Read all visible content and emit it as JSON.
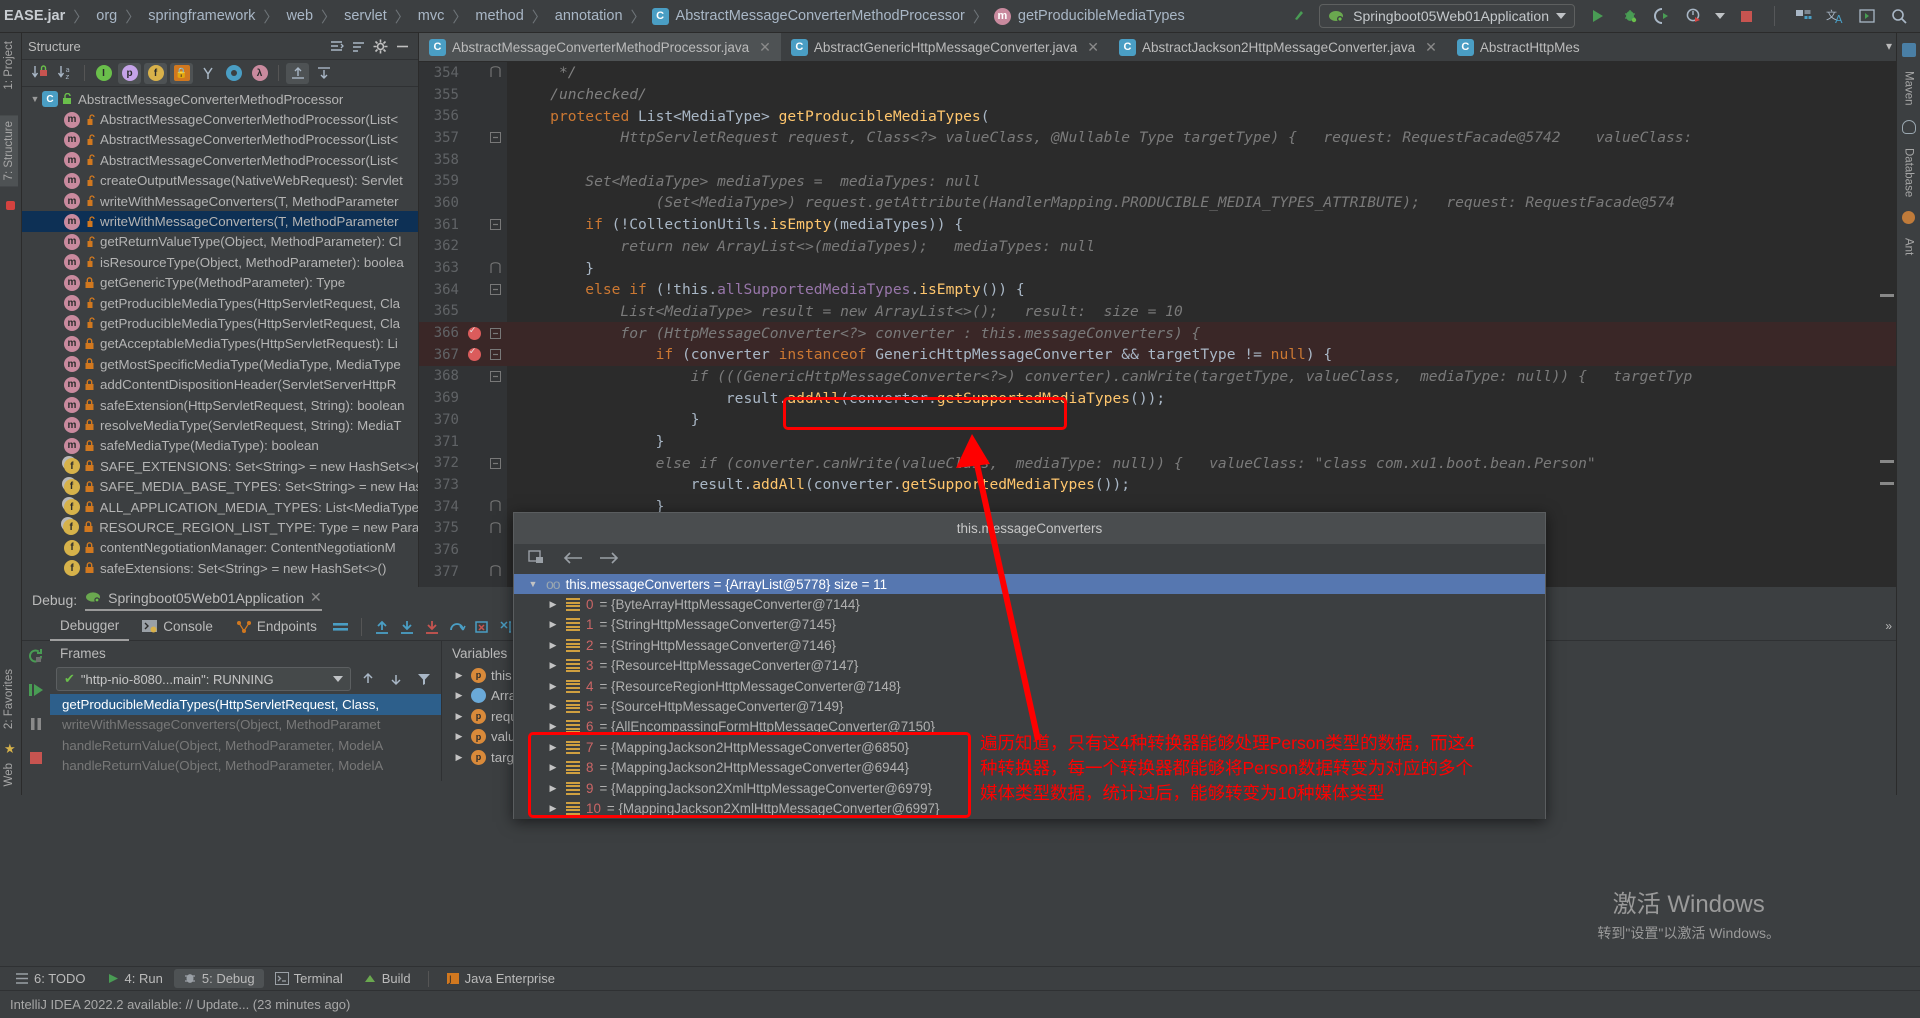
{
  "topbar": {
    "breadcrumb": [
      {
        "text": "EASE.jar",
        "bold": true
      },
      {
        "text": "org"
      },
      {
        "text": "springframework"
      },
      {
        "text": "web"
      },
      {
        "text": "servlet"
      },
      {
        "text": "mvc"
      },
      {
        "text": "method"
      },
      {
        "text": "annotation"
      },
      {
        "text": "AbstractMessageConverterMethodProcessor",
        "icon": "class"
      },
      {
        "text": "getProducibleMediaTypes",
        "icon": "method"
      }
    ],
    "run_config": "Springboot05Web01Application",
    "buttons": [
      "run",
      "debug",
      "run-with-coverage",
      "profiler",
      "stop",
      "services",
      "translate",
      "console",
      "search"
    ]
  },
  "left_rail": {
    "tabs": [
      "1: Project",
      "7: Structure"
    ]
  },
  "right_rail": {
    "tabs": [
      "Maven",
      "Database",
      "Ant"
    ]
  },
  "structure": {
    "title": "Structure",
    "toolbar_icons": [
      "sort-by-visibility",
      "sort-alphabetically",
      "inherited",
      "properties",
      "fields",
      "non-public",
      "anonymous",
      "interfaces",
      "lambdas",
      "expand-all",
      "collapse-all"
    ],
    "tree": [
      {
        "indent": 0,
        "icon": "class",
        "lock": "public",
        "label": "AbstractMessageConverterMethodProcessor",
        "arrow": true,
        "selected": false
      },
      {
        "indent": 1,
        "icon": "method",
        "lock": "protected",
        "label": "AbstractMessageConverterMethodProcessor(List<",
        "selected": false
      },
      {
        "indent": 1,
        "icon": "method",
        "lock": "protected",
        "label": "AbstractMessageConverterMethodProcessor(List<",
        "selected": false
      },
      {
        "indent": 1,
        "icon": "method",
        "lock": "protected",
        "label": "AbstractMessageConverterMethodProcessor(List<",
        "selected": false
      },
      {
        "indent": 1,
        "icon": "method",
        "lock": "protected",
        "label": "createOutputMessage(NativeWebRequest): Servlet",
        "selected": false
      },
      {
        "indent": 1,
        "icon": "method",
        "lock": "protected",
        "label": "writeWithMessageConverters(T, MethodParameter",
        "selected": false
      },
      {
        "indent": 1,
        "icon": "method",
        "lock": "protected",
        "label": "writeWithMessageConverters(T, MethodParameter",
        "selected": true
      },
      {
        "indent": 1,
        "icon": "method",
        "lock": "protected",
        "label": "getReturnValueType(Object, MethodParameter): Cl",
        "selected": false
      },
      {
        "indent": 1,
        "icon": "method",
        "lock": "protected",
        "label": "isResourceType(Object, MethodParameter): boolea",
        "selected": false
      },
      {
        "indent": 1,
        "icon": "method",
        "lock": "private",
        "label": "getGenericType(MethodParameter): Type",
        "selected": false
      },
      {
        "indent": 1,
        "icon": "method",
        "lock": "protected",
        "label": "getProducibleMediaTypes(HttpServletRequest, Cla",
        "selected": false
      },
      {
        "indent": 1,
        "icon": "method",
        "lock": "protected",
        "label": "getProducibleMediaTypes(HttpServletRequest, Cla",
        "selected": false
      },
      {
        "indent": 1,
        "icon": "method",
        "lock": "private",
        "label": "getAcceptableMediaTypes(HttpServletRequest): Li",
        "selected": false
      },
      {
        "indent": 1,
        "icon": "method",
        "lock": "private",
        "label": "getMostSpecificMediaType(MediaType, MediaType",
        "selected": false
      },
      {
        "indent": 1,
        "icon": "method",
        "lock": "private",
        "label": "addContentDispositionHeader(ServletServerHttpR",
        "selected": false
      },
      {
        "indent": 1,
        "icon": "method",
        "lock": "private",
        "label": "safeExtension(HttpServletRequest, String): boolean",
        "selected": false
      },
      {
        "indent": 1,
        "icon": "method",
        "lock": "private",
        "label": "resolveMediaType(ServletRequest, String): MediaT",
        "selected": false
      },
      {
        "indent": 1,
        "icon": "method",
        "lock": "private",
        "label": "safeMediaType(MediaType): boolean",
        "selected": false
      },
      {
        "indent": 1,
        "icon": "field-static",
        "lock": "private",
        "label": "SAFE_EXTENSIONS: Set<String> = new HashSet<>(",
        "selected": false
      },
      {
        "indent": 1,
        "icon": "field-static",
        "lock": "private",
        "label": "SAFE_MEDIA_BASE_TYPES: Set<String> = new Hash",
        "selected": false
      },
      {
        "indent": 1,
        "icon": "field-static",
        "lock": "private",
        "label": "ALL_APPLICATION_MEDIA_TYPES: List<MediaType>",
        "selected": false
      },
      {
        "indent": 1,
        "icon": "field-static",
        "lock": "private",
        "label": "RESOURCE_REGION_LIST_TYPE: Type = new Parame",
        "selected": false
      },
      {
        "indent": 1,
        "icon": "field",
        "lock": "private",
        "label": "contentNegotiationManager: ContentNegotiationM",
        "selected": false
      },
      {
        "indent": 1,
        "icon": "field",
        "lock": "private",
        "label": "safeExtensions: Set<String> = new HashSet<>()",
        "selected": false
      }
    ]
  },
  "editor": {
    "tabs": [
      {
        "label": "AbstractMessageConverterMethodProcessor.java",
        "active": true,
        "closable": true
      },
      {
        "label": "AbstractGenericHttpMessageConverter.java",
        "active": false,
        "closable": true
      },
      {
        "label": "AbstractJackson2HttpMessageConverter.java",
        "active": false,
        "closable": true
      },
      {
        "label": "AbstractHttpMes",
        "active": false,
        "closable": false
      }
    ],
    "lines": [
      {
        "num": "354",
        "fold": "end",
        "text": "     */"
      },
      {
        "num": "355",
        "fold": "",
        "text": "    /unchecked/"
      },
      {
        "num": "356",
        "fold": "",
        "text": "    protected List<MediaType> getProducibleMediaTypes("
      },
      {
        "num": "357",
        "fold": "start",
        "text": "            HttpServletRequest request, Class<?> valueClass, @Nullable Type targetType) {   request: RequestFacade@5742    valueClass:"
      },
      {
        "num": "358",
        "fold": "",
        "text": ""
      },
      {
        "num": "359",
        "fold": "",
        "text": "        Set<MediaType> mediaTypes =  mediaTypes: null"
      },
      {
        "num": "360",
        "fold": "",
        "text": "                (Set<MediaType>) request.getAttribute(HandlerMapping.PRODUCIBLE_MEDIA_TYPES_ATTRIBUTE);   request: RequestFacade@574"
      },
      {
        "num": "361",
        "fold": "start",
        "text": "        if (!CollectionUtils.isEmpty(mediaTypes)) {"
      },
      {
        "num": "362",
        "fold": "",
        "text": "            return new ArrayList<>(mediaTypes);   mediaTypes: null"
      },
      {
        "num": "363",
        "fold": "end",
        "text": "        }"
      },
      {
        "num": "364",
        "fold": "start",
        "text": "        else if (!this.allSupportedMediaTypes.isEmpty()) {"
      },
      {
        "num": "365",
        "fold": "",
        "text": "            List<MediaType> result = new ArrayList<>();   result:  size = 10"
      },
      {
        "num": "366",
        "fold": "start",
        "text": "            for (HttpMessageConverter<?> converter : this.messageConverters) {",
        "breakpoint": true,
        "highlight": true
      },
      {
        "num": "367",
        "fold": "start",
        "text": "                if (converter instanceof GenericHttpMessageConverter && targetType != null) {",
        "breakpoint": true,
        "highlight": true
      },
      {
        "num": "368",
        "fold": "start",
        "text": "                    if (((GenericHttpMessageConverter<?>) converter).canWrite(targetType, valueClass,  mediaType: null)) {   targetTyp"
      },
      {
        "num": "369",
        "fold": "",
        "text": "                        result.addAll(converter.getSupportedMediaTypes());"
      },
      {
        "num": "370",
        "fold": "",
        "text": "                    }"
      },
      {
        "num": "371",
        "fold": "",
        "text": "                }"
      },
      {
        "num": "372",
        "fold": "start",
        "text": "                else if (converter.canWrite(valueClass,  mediaType: null)) {   valueClass: \"class com.xu1.boot.bean.Person\""
      },
      {
        "num": "373",
        "fold": "",
        "text": "                    result.addAll(converter.getSupportedMediaTypes());"
      },
      {
        "num": "374",
        "fold": "end",
        "text": "                }"
      },
      {
        "num": "375",
        "fold": "end",
        "text": ""
      },
      {
        "num": "376",
        "fold": "",
        "text": ""
      },
      {
        "num": "377",
        "fold": "end",
        "text": ""
      }
    ]
  },
  "annotation": {
    "note_text": "遍历知道，只有这4种转换器能够处理Person类型的数据，而这4\n种转换器，每一个转换器都能够将Person数据转变为对应的多个\n媒体类型数据，统计过后，能够转变为10种媒体类型",
    "color": "#ff0000"
  },
  "debug": {
    "label": "Debug:",
    "session": "Springboot05Web01Application",
    "tabs": [
      {
        "label": "Debugger",
        "active": true
      },
      {
        "label": "Console",
        "active": false
      },
      {
        "label": "Endpoints",
        "active": false
      }
    ],
    "toolbar_icons": [
      "rerun",
      "resume",
      "step-over",
      "step-into",
      "force-step-into",
      "step-out",
      "drop-frame",
      "run-to-cursor",
      "evaluate"
    ],
    "frames_header": "Frames",
    "variables_header": "Variables",
    "thread_selector": "\"http-nio-8080...main\": RUNNING",
    "frames": [
      {
        "label": "getProducibleMediaTypes(HttpServletRequest, Class,",
        "selected": true
      },
      {
        "label": "writeWithMessageConverters(Object, MethodParamet",
        "selected": false
      },
      {
        "label": "handleReturnValue(Object, MethodParameter, ModelA",
        "selected": false
      },
      {
        "label": "handleReturnValue(Object, MethodParameter, ModelA",
        "selected": false
      }
    ],
    "variables": [
      {
        "icon": "p",
        "label": "this = {Re"
      },
      {
        "icon": "blue",
        "label": "ArrayList"
      },
      {
        "icon": "p",
        "label": "request = "
      },
      {
        "icon": "p",
        "label": "valueClas"
      },
      {
        "icon": "p",
        "label": "targetTyp"
      }
    ]
  },
  "popup": {
    "title": "this.messageConverters",
    "toolbar_icons": [
      "copy-to-clipboard",
      "back-arrow",
      "forward-arrow"
    ],
    "rows": [
      {
        "depth": 0,
        "arrow": "down",
        "icon": "oo",
        "label": "this.messageConverters = {ArrayList@5778}  size = 11",
        "selected": true
      },
      {
        "depth": 1,
        "arrow": "right",
        "icon": "list",
        "index": "0",
        "label": "= {ByteArrayHttpMessageConverter@7144}"
      },
      {
        "depth": 1,
        "arrow": "right",
        "icon": "list",
        "index": "1",
        "label": "= {StringHttpMessageConverter@7145}"
      },
      {
        "depth": 1,
        "arrow": "right",
        "icon": "list",
        "index": "2",
        "label": "= {StringHttpMessageConverter@7146}"
      },
      {
        "depth": 1,
        "arrow": "right",
        "icon": "list",
        "index": "3",
        "label": "= {ResourceHttpMessageConverter@7147}"
      },
      {
        "depth": 1,
        "arrow": "right",
        "icon": "list",
        "index": "4",
        "label": "= {ResourceRegionHttpMessageConverter@7148}"
      },
      {
        "depth": 1,
        "arrow": "right",
        "icon": "list",
        "index": "5",
        "label": "= {SourceHttpMessageConverter@7149}"
      },
      {
        "depth": 1,
        "arrow": "right",
        "icon": "list",
        "index": "6",
        "label": "= {AllEncompassingFormHttpMessageConverter@7150}"
      },
      {
        "depth": 1,
        "arrow": "right",
        "icon": "list",
        "index": "7",
        "label": "= {MappingJackson2HttpMessageConverter@6850}"
      },
      {
        "depth": 1,
        "arrow": "right",
        "icon": "list",
        "index": "8",
        "label": "= {MappingJackson2HttpMessageConverter@6944}"
      },
      {
        "depth": 1,
        "arrow": "right",
        "icon": "list",
        "index": "9",
        "label": "= {MappingJackson2XmlHttpMessageConverter@6979}"
      },
      {
        "depth": 1,
        "arrow": "right",
        "icon": "list",
        "index": "10",
        "label": "= {MappingJackson2XmlHttpMessageConverter@6997}"
      }
    ]
  },
  "watermark": {
    "line1": "激活 Windows",
    "line2": "转到\"设置\"以激活 Windows。"
  },
  "bottombar": {
    "items": [
      {
        "label": "6: TODO",
        "icon": "todo-icon",
        "active": false
      },
      {
        "label": "4: Run",
        "icon": "run-icon",
        "active": false
      },
      {
        "label": "5: Debug",
        "icon": "debug-icon",
        "active": true
      },
      {
        "label": "Terminal",
        "icon": "terminal-icon",
        "active": false
      },
      {
        "label": "Build",
        "icon": "build-icon",
        "active": false
      },
      {
        "label": "Java Enterprise",
        "icon": "java-icon",
        "active": false
      }
    ]
  },
  "statusbar": {
    "text": "IntelliJ IDEA 2022.2 available: // Update... (23 minutes ago)"
  }
}
